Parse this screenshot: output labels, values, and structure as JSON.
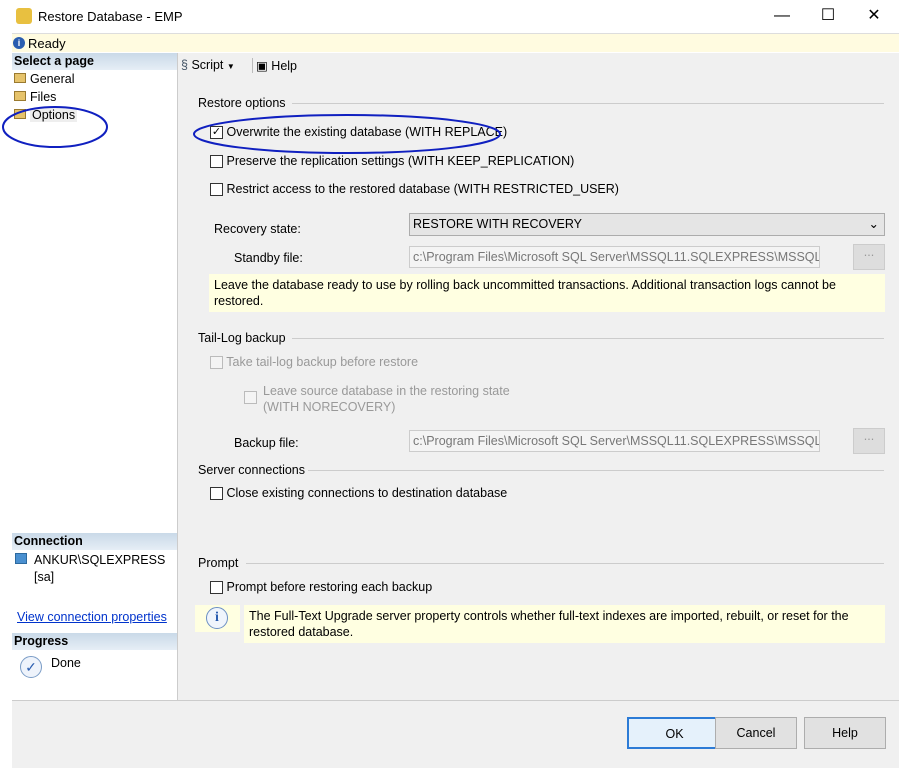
{
  "window": {
    "title": "Restore Database - EMP",
    "minimize": "—",
    "maximize": "☐",
    "close": "✕"
  },
  "status": {
    "text": "Ready",
    "icon": "info-icon"
  },
  "sidebar": {
    "header": "Select a page",
    "items": [
      {
        "label": "General"
      },
      {
        "label": "Files"
      },
      {
        "label": "Options"
      }
    ],
    "connection_header": "Connection",
    "server": "ANKUR\\SQLEXPRESS",
    "user": "[sa]",
    "view_connection": "View connection properties",
    "progress_header": "Progress",
    "progress_status": "Done"
  },
  "toolbar": {
    "script": "Script",
    "help": "Help"
  },
  "restore_options": {
    "title": "Restore options",
    "overwrite": {
      "label": "Overwrite the existing database (WITH REPLACE)",
      "checked": true
    },
    "preserve": {
      "label": "Preserve the replication settings (WITH KEEP_REPLICATION)",
      "checked": false
    },
    "restrict": {
      "label": "Restrict access to the restored database (WITH RESTRICTED_USER)",
      "checked": false
    },
    "recovery_label": "Recovery state:",
    "recovery_value": "RESTORE WITH RECOVERY",
    "standby_label": "Standby file:",
    "standby_value": "c:\\Program Files\\Microsoft SQL Server\\MSSQL11.SQLEXPRESS\\MSSQL\\Bac",
    "browse": "...",
    "info": "Leave the database ready to use by rolling back uncommitted transactions. Additional transaction logs cannot be restored."
  },
  "tail_log": {
    "title": "Tail-Log backup",
    "take": "Take tail-log backup before restore",
    "leave": "Leave source database in the restoring state",
    "leave2": "(WITH NORECOVERY)",
    "backup_label": "Backup file:",
    "backup_value": "c:\\Program Files\\Microsoft SQL Server\\MSSQL11.SQLEXPRESS\\MSSQL\\Bac",
    "browse": "..."
  },
  "server_connections": {
    "title": "Server connections",
    "close": "Close existing connections to destination database"
  },
  "prompt": {
    "title": "Prompt",
    "before": "Prompt before restoring each backup",
    "info": "The Full-Text Upgrade server property controls whether full-text indexes are imported, rebuilt, or reset for the restored database."
  },
  "buttons": {
    "ok": "OK",
    "cancel": "Cancel",
    "help": "Help"
  }
}
